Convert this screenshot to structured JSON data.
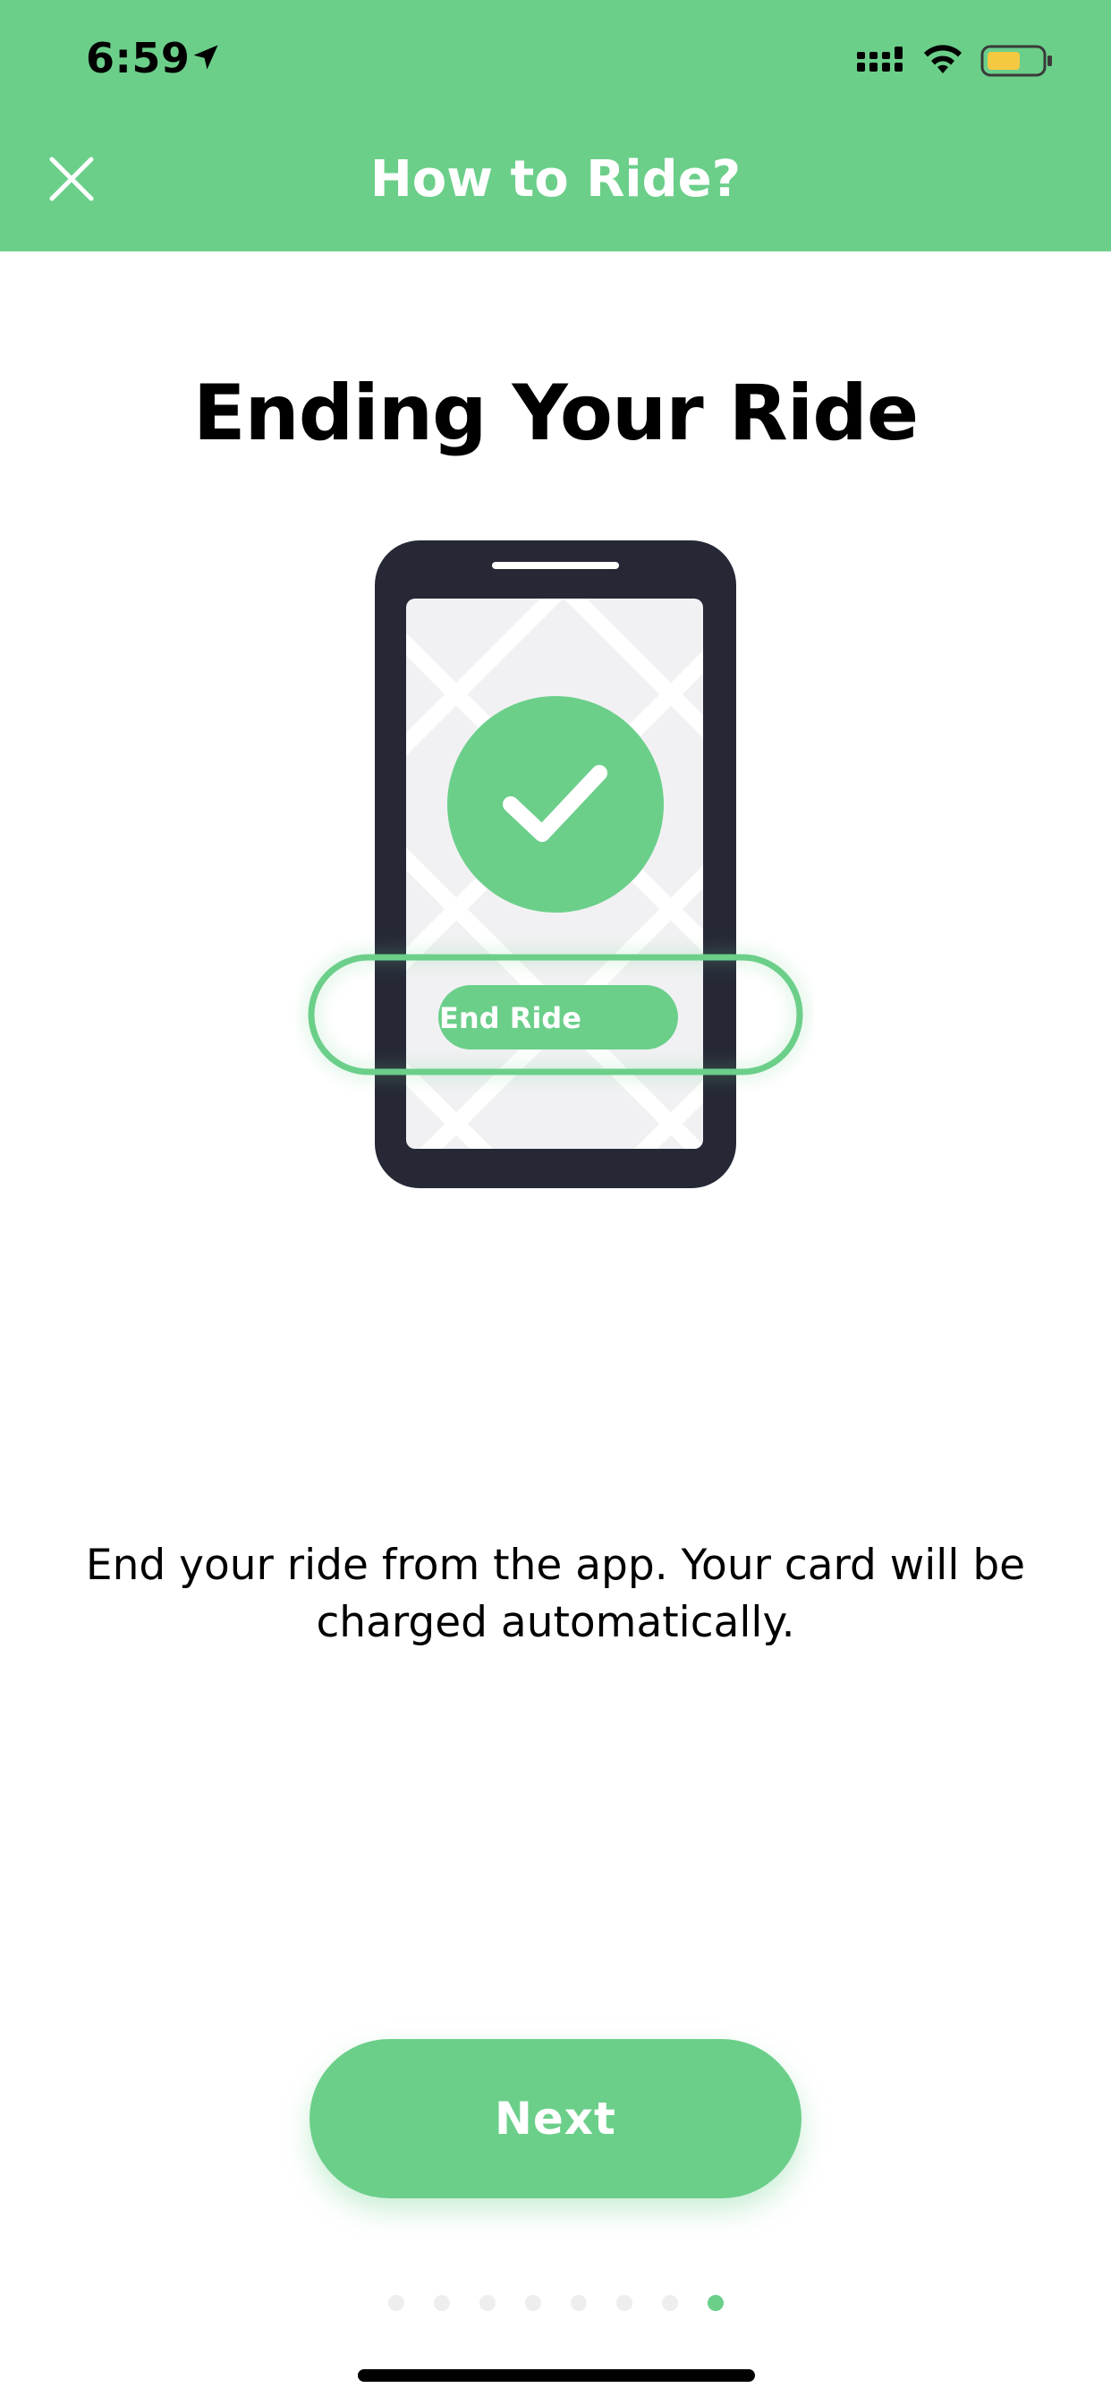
{
  "status_bar": {
    "time": "6:59",
    "icons": [
      "location-arrow-icon",
      "cellular-signal-icon",
      "wifi-icon",
      "battery-icon"
    ]
  },
  "header": {
    "title": "How to Ride?",
    "close_icon": "close-icon",
    "background_color": "#6bcf8a"
  },
  "page": {
    "title": "Ending Your Ride",
    "illustration": {
      "button_label": "End Ride",
      "icon": "checkmark-icon"
    },
    "description": "End your ride from the app. Your card will be charged automatically."
  },
  "next_button": {
    "label": "Next"
  },
  "pagination": {
    "total": 8,
    "active_index": 7
  },
  "colors": {
    "accent": "#6bcf8a",
    "phone_body": "#262836",
    "battery_fill": "#f5c842"
  }
}
